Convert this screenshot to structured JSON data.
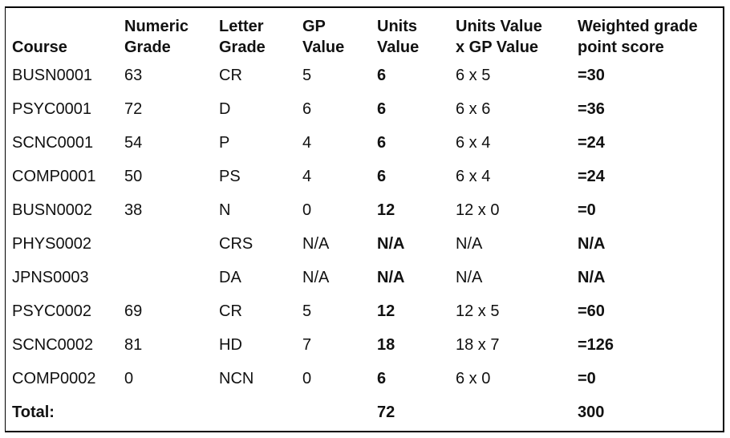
{
  "headers": [
    "Course",
    "Numeric\nGrade",
    "Letter\nGrade",
    "GP\nValue",
    "Units\nValue",
    "Units Value\nx GP Value",
    "Weighted grade\npoint score"
  ],
  "header_lines": [
    [
      "",
      "Course"
    ],
    [
      "Numeric",
      "Grade"
    ],
    [
      "Letter",
      "Grade"
    ],
    [
      "GP",
      "Value"
    ],
    [
      "Units",
      "Value"
    ],
    [
      "Units Value",
      "x GP Value"
    ],
    [
      "Weighted grade",
      "point score"
    ]
  ],
  "rows": [
    {
      "course": "BUSN0001",
      "numeric": "63",
      "letter": "CR",
      "gp": "5",
      "units": "6",
      "calc": "6 x 5",
      "weighted": "=30"
    },
    {
      "course": "PSYC0001",
      "numeric": "72",
      "letter": "D",
      "gp": "6",
      "units": "6",
      "calc": "6 x 6",
      "weighted": "=36"
    },
    {
      "course": "SCNC0001",
      "numeric": "54",
      "letter": "P",
      "gp": "4",
      "units": "6",
      "calc": "6 x 4",
      "weighted": "=24"
    },
    {
      "course": "COMP0001",
      "numeric": "50",
      "letter": "PS",
      "gp": "4",
      "units": "6",
      "calc": "6 x 4",
      "weighted": "=24"
    },
    {
      "course": "BUSN0002",
      "numeric": "38",
      "letter": "N",
      "gp": "0",
      "units": "12",
      "calc": "12 x 0",
      "weighted": "=0"
    },
    {
      "course": "PHYS0002",
      "numeric": "",
      "letter": "CRS",
      "gp": "N/A",
      "units": "N/A",
      "calc": "N/A",
      "weighted": "N/A"
    },
    {
      "course": "JPNS0003",
      "numeric": "",
      "letter": "DA",
      "gp": "N/A",
      "units": "N/A",
      "calc": "N/A",
      "weighted": "N/A"
    },
    {
      "course": "PSYC0002",
      "numeric": "69",
      "letter": "CR",
      "gp": "5",
      "units": "12",
      "calc": "12 x 5",
      "weighted": "=60"
    },
    {
      "course": "SCNC0002",
      "numeric": "81",
      "letter": "HD",
      "gp": "7",
      "units": "18",
      "calc": "18 x 7",
      "weighted": "=126"
    },
    {
      "course": "COMP0002",
      "numeric": "0",
      "letter": "NCN",
      "gp": "0",
      "units": "6",
      "calc": "6 x 0",
      "weighted": "=0"
    }
  ],
  "total": {
    "label": "Total:",
    "units": "72",
    "weighted": "300"
  }
}
